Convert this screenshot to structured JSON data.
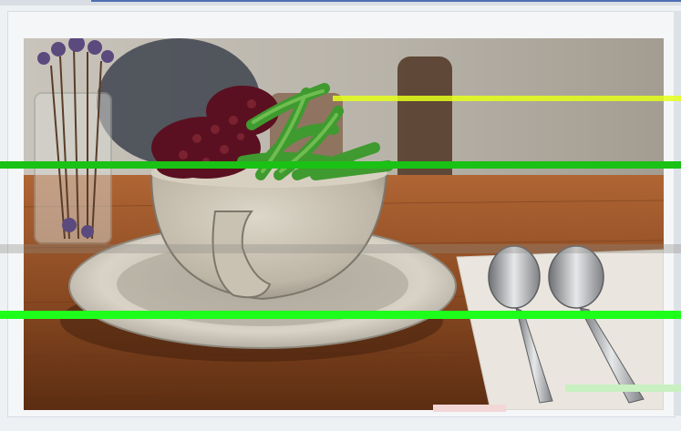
{
  "image": {
    "description_icons": {
      "dessert-bowl-icon": "bowl",
      "spoon-icon": "spoon",
      "flower-vase-icon": "vase"
    },
    "colors": {
      "background": "#eef1f4",
      "table": "#8a4a22",
      "bowl": "#c9c2b4",
      "plate": "#d8d3c6",
      "napkin": "#eae6df",
      "beans": "#5a1020",
      "green_topping": "#3f9a2f",
      "glitch_green": "#1dff1a",
      "glitch_yellow": "#e5ff1a"
    }
  }
}
